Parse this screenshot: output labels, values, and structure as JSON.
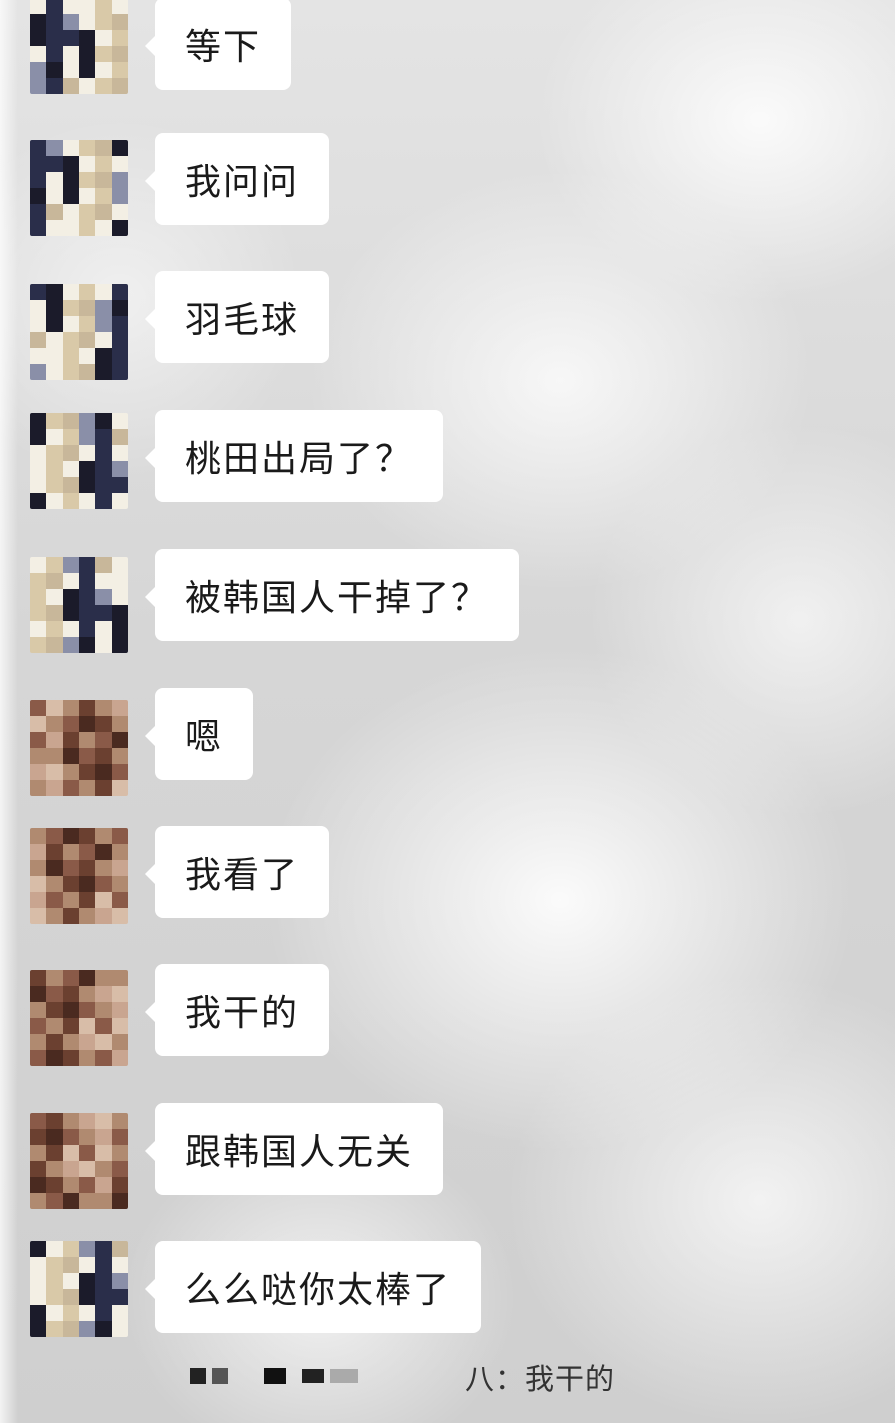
{
  "chat": {
    "messages": [
      {
        "text": "等下",
        "avatar": "avatar-a"
      },
      {
        "text": "我问问",
        "avatar": "avatar-a"
      },
      {
        "text": "羽毛球",
        "avatar": "avatar-a"
      },
      {
        "text": "桃田出局了？",
        "avatar": "avatar-a"
      },
      {
        "text": "被韩国人干掉了？",
        "avatar": "avatar-a"
      },
      {
        "text": "嗯",
        "avatar": "avatar-b"
      },
      {
        "text": "我看了",
        "avatar": "avatar-b"
      },
      {
        "text": "我干的",
        "avatar": "avatar-b"
      },
      {
        "text": "跟韩国人无关",
        "avatar": "avatar-b"
      },
      {
        "text": "么么哒你太棒了",
        "avatar": "avatar-a"
      }
    ],
    "notice": {
      "text": "八：我干的"
    }
  },
  "colors": {
    "bubble": "#ffffff",
    "text": "#1a1a1a",
    "avatar_a_palette": [
      "#f3efe4",
      "#2a2e4a",
      "#d9c9a8",
      "#8a8fa8",
      "#1b1b2a",
      "#c8b79a"
    ],
    "avatar_b_palette": [
      "#b08a70",
      "#6b4030",
      "#d8bda8",
      "#8a5a48",
      "#4a2a20",
      "#c9a590"
    ]
  }
}
